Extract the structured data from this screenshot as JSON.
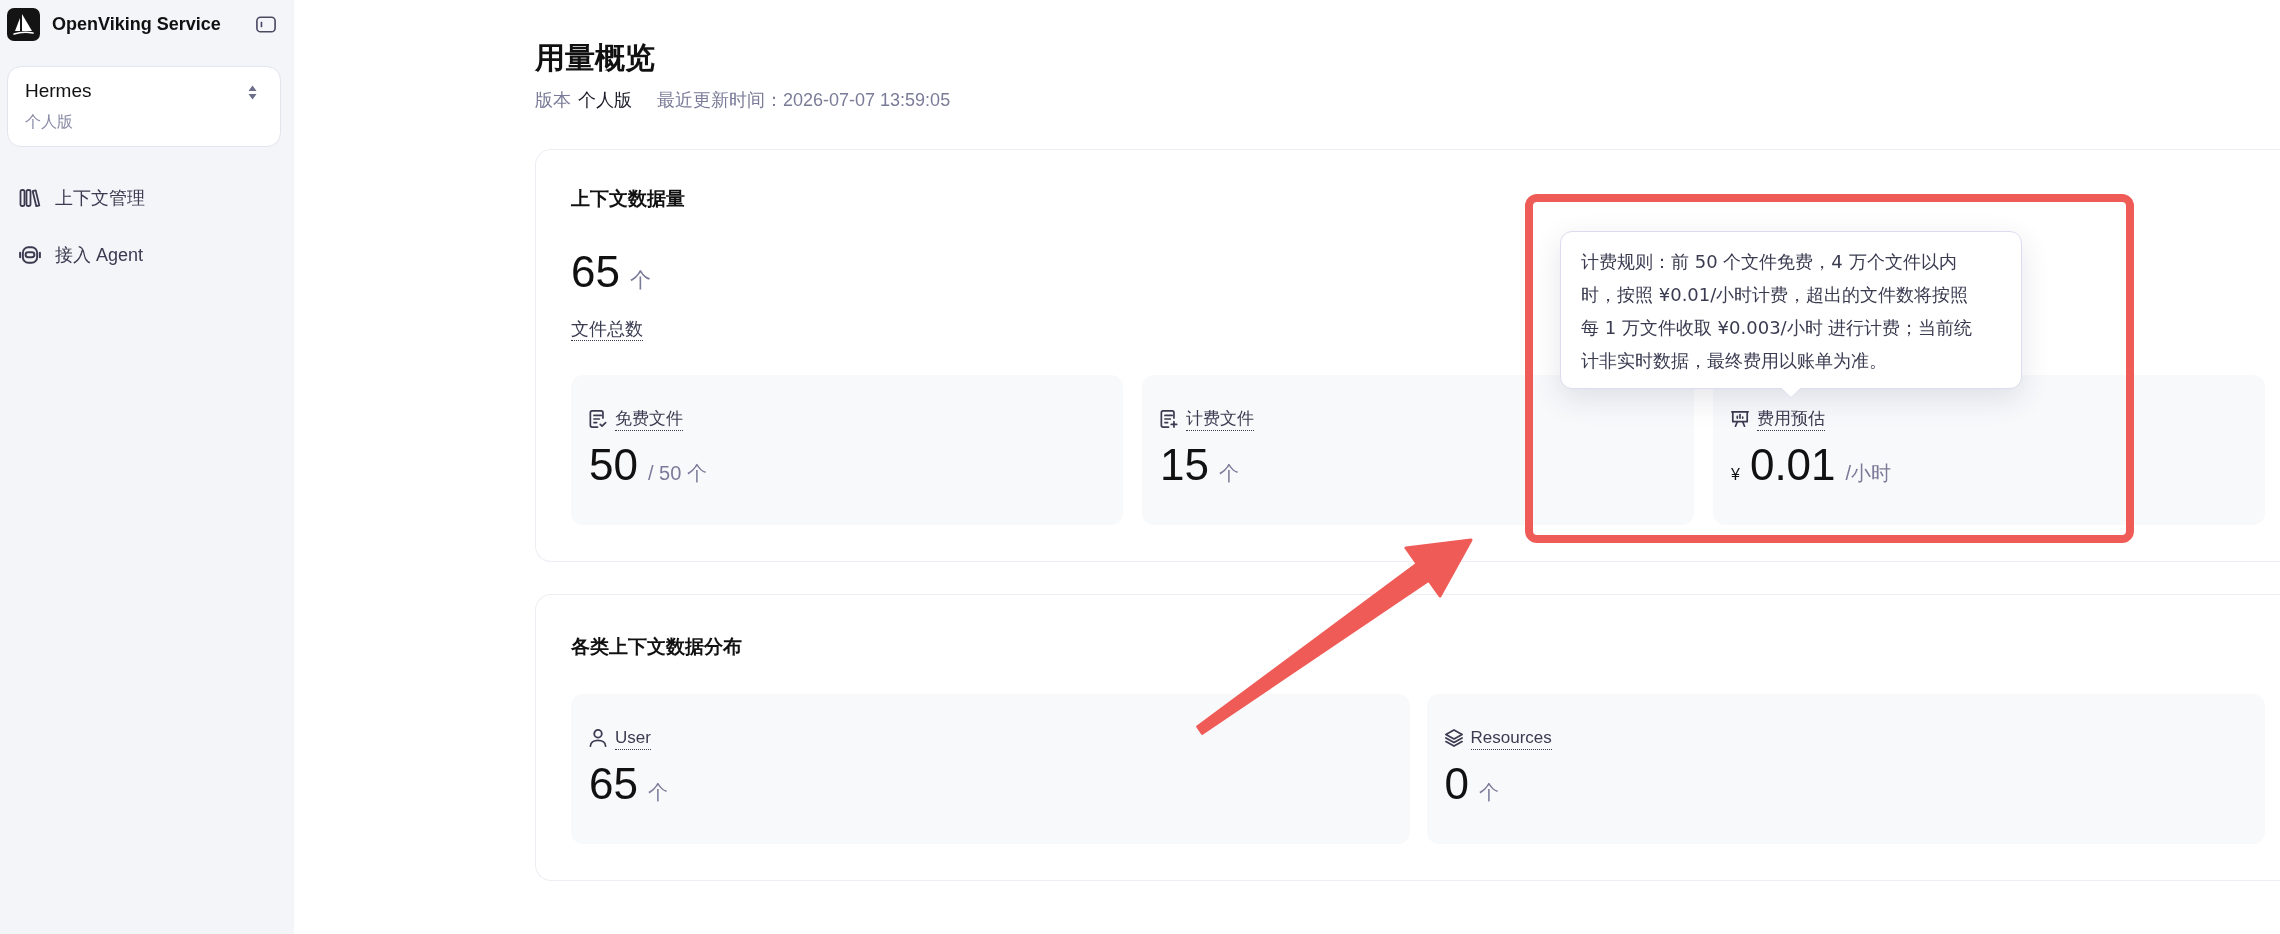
{
  "sidebar": {
    "app_name": "OpenViking Service",
    "workspace": {
      "name": "Hermes",
      "plan": "个人版"
    },
    "nav_items": [
      {
        "kind": "context",
        "label": "上下文管理",
        "selected": false
      },
      {
        "kind": "agent",
        "label": "接入 Agent",
        "selected": false
      }
    ]
  },
  "header": {
    "title": "用量概览",
    "edition_label": "版本",
    "edition": "个人版",
    "updated": "最近更新时间：2026-07-07 13:59:05"
  },
  "data_volume": {
    "title": "上下文数据量",
    "total": {
      "value": "65",
      "unit": "个",
      "label": "文件总数"
    },
    "stats": [
      {
        "kind": "free",
        "label": "免费文件",
        "value": "50",
        "unit": "/ 50 个",
        "highlighted": false
      },
      {
        "kind": "billed",
        "label": "计费文件",
        "value": "15",
        "unit": "个",
        "highlighted": false
      },
      {
        "kind": "cost",
        "label": "费用预估",
        "prefix": "¥",
        "value": "0.01",
        "unit": "/小时",
        "highlighted": true,
        "tooltip": "计费规则：前 50 个文件免费，4 万个文件以内时，按照 ¥0.01/小时计费，超出的文件数将按照每 1 万文件收取 ¥0.003/小时 进行计费；当前统计非实时数据，最终费用以账单为准。"
      }
    ]
  },
  "distribution": {
    "title": "各类上下文数据分布",
    "stats": [
      {
        "kind": "user",
        "label": "User",
        "value": "65",
        "unit": "个",
        "highlighted": false
      },
      {
        "kind": "resources",
        "label": "Resources",
        "value": "0",
        "unit": "个",
        "highlighted": false
      }
    ]
  }
}
